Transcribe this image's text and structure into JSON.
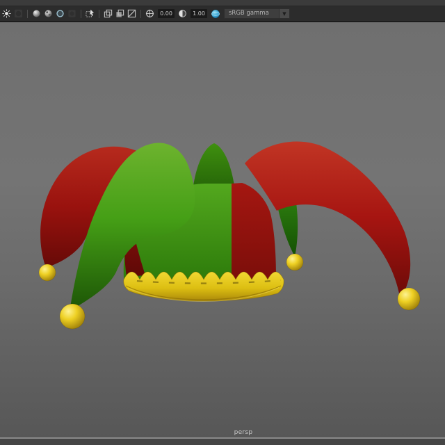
{
  "toolbar": {
    "icons": [
      "lighting-icon",
      "shadows-icon",
      "smooth-shade-icon",
      "textured-icon",
      "wireframe-on-shaded-icon",
      "use-default-material-icon",
      "object-selection-icon",
      "stacked-frames-icon",
      "stacked-frames-filled-icon",
      "xray-icon",
      "exposure-icon",
      "contrast-icon",
      "color-management-icon"
    ],
    "exposure_value": "0.00",
    "gamma_value": "1.00",
    "view_transform": "sRGB gamma",
    "dropdown_arrow": "▼"
  },
  "viewport": {
    "camera_label": "persp",
    "model": {
      "name": "jester-hat",
      "parts": [
        "left-red-horn",
        "left-green-horn",
        "back-green-horn",
        "right-red-horn",
        "right-green-point",
        "front-green-panel",
        "front-red-panel",
        "crown-band",
        "tip-ball-1",
        "tip-ball-2",
        "tip-ball-3",
        "tip-ball-4"
      ]
    }
  },
  "colors": {
    "viewport_bg_top": "#737373",
    "viewport_bg_bottom": "#575757",
    "toolbar_bg": "#2c2c2c",
    "hat_red": "#a61511",
    "hat_green": "#459f16",
    "hat_yellow": "#ddbf12",
    "accent_blue": "#3aa6d6"
  }
}
